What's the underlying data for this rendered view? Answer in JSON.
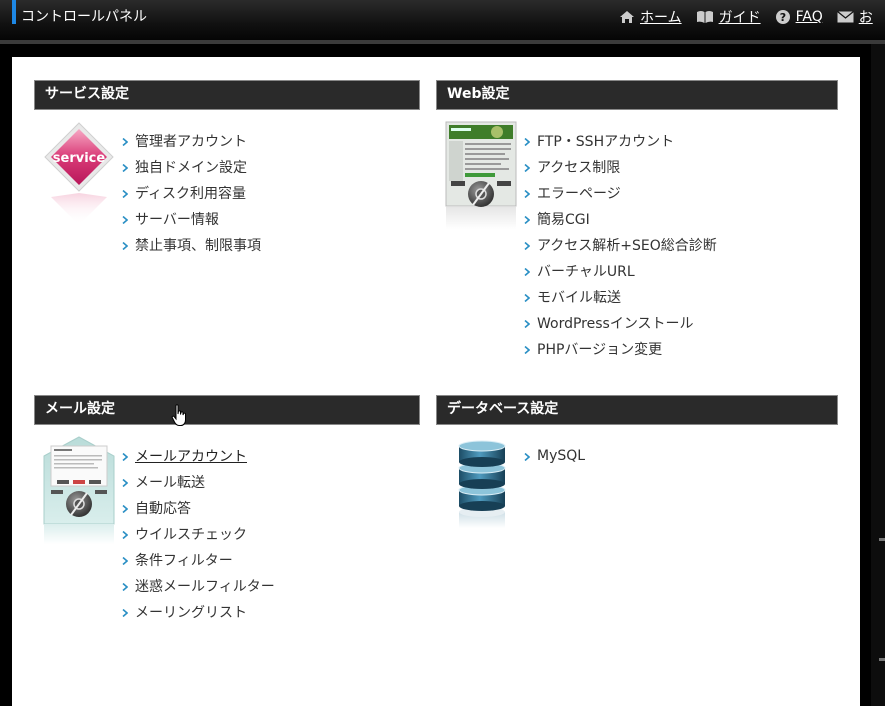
{
  "topbar": {
    "title": "コントロールパネル",
    "nav": [
      {
        "label": "ホーム",
        "icon": "home-icon"
      },
      {
        "label": "ガイド",
        "icon": "book-icon"
      },
      {
        "label": "FAQ",
        "icon": "help-icon"
      },
      {
        "label": "お",
        "icon": "mail-icon"
      }
    ]
  },
  "sections": {
    "service": {
      "title": "サービス設定",
      "icon": "service-badge-icon",
      "icon_text": "service",
      "items": [
        "管理者アカウント",
        "独自ドメイン設定",
        "ディスク利用容量",
        "サーバー情報",
        "禁止事項、制限事項"
      ]
    },
    "web": {
      "title": "Web設定",
      "icon": "web-settings-icon",
      "items": [
        "FTP・SSHアカウント",
        "アクセス制限",
        "エラーページ",
        "簡易CGI",
        "アクセス解析+SEO総合診断",
        "バーチャルURL",
        "モバイル転送",
        "WordPressインストール",
        "PHPバージョン変更"
      ]
    },
    "mail": {
      "title": "メール設定",
      "icon": "mail-settings-icon",
      "items": [
        "メールアカウント",
        "メール転送",
        "自動応答",
        "ウイルスチェック",
        "条件フィルター",
        "迷惑メールフィルター",
        "メーリングリスト"
      ]
    },
    "db": {
      "title": "データベース設定",
      "icon": "database-icon",
      "items": [
        "MySQL"
      ]
    }
  },
  "colors": {
    "accent": "#1e88e5",
    "arrow": "#2a8fc4",
    "header_bg": "#2a2a2a"
  }
}
